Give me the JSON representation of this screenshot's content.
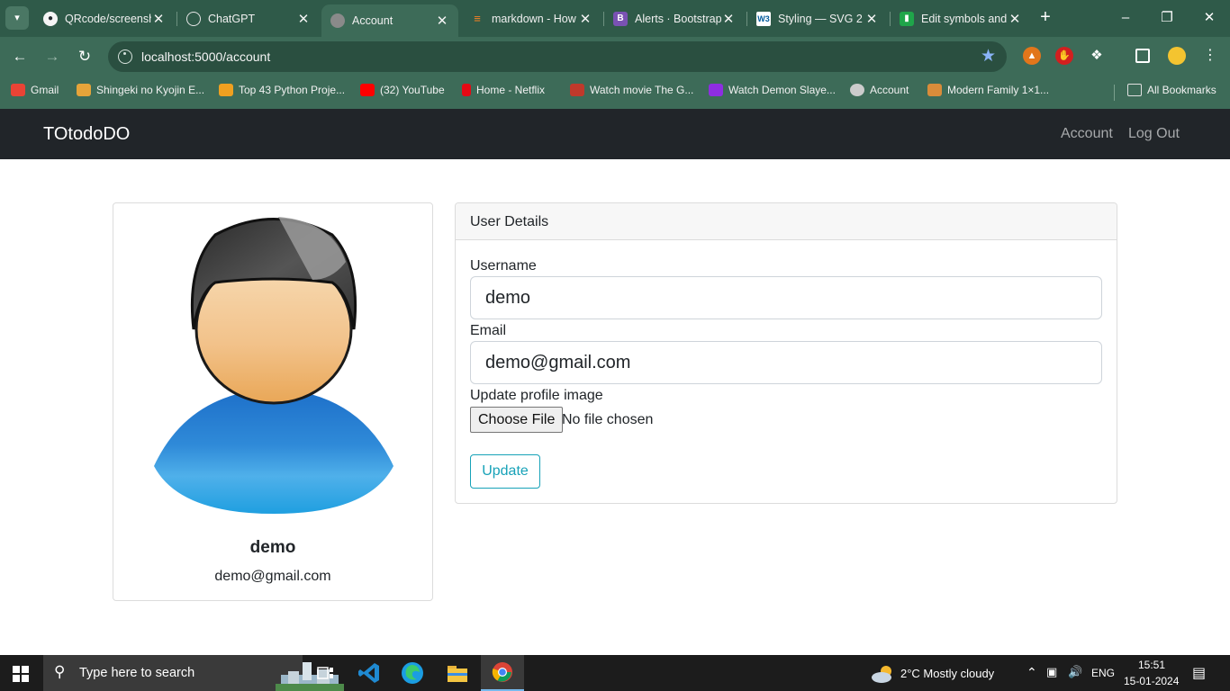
{
  "browser": {
    "tabs": [
      {
        "title": "QRcode/screensh",
        "favicon": "github-icon",
        "color": "#24292e"
      },
      {
        "title": "ChatGPT",
        "favicon": "openai-icon",
        "color": "#6b8f7e"
      },
      {
        "title": "Account",
        "favicon": "globe-icon",
        "color": "#888888",
        "active": true
      },
      {
        "title": "markdown - How",
        "favicon": "stackoverflow-icon",
        "color": "#f48024"
      },
      {
        "title": "Alerts · Bootstrap",
        "favicon": "bootstrap-icon",
        "color": "#7952b3"
      },
      {
        "title": "Styling — SVG 2",
        "favicon": "w3c-icon",
        "color": "#005a9c"
      },
      {
        "title": "Edit symbols and",
        "favicon": "editor-icon",
        "color": "#1fa54a"
      }
    ],
    "address": "localhost:5000/account",
    "bookmarks": [
      {
        "label": "Gmail",
        "color": "#ea4335"
      },
      {
        "label": "Shingeki no Kyojin E...",
        "color": "#e6a43a"
      },
      {
        "label": "Top 43 Python Proje...",
        "color": "#f0a020"
      },
      {
        "label": "(32) YouTube",
        "color": "#ff0000"
      },
      {
        "label": "Home - Netflix",
        "color": "#e50914"
      },
      {
        "label": "Watch movie The G...",
        "color": "#c0392b"
      },
      {
        "label": "Watch Demon Slaye...",
        "color": "#8e2de2"
      },
      {
        "label": "Account",
        "color": "#cccccc"
      },
      {
        "label": "Modern Family 1×1...",
        "color": "#d98c3a"
      }
    ],
    "all_bookmarks": "All Bookmarks"
  },
  "app": {
    "brand": "TOtodoDO",
    "nav": {
      "account": "Account",
      "logout": "Log Out"
    }
  },
  "profile": {
    "name": "demo",
    "email": "demo@gmail.com"
  },
  "details": {
    "header": "User Details",
    "username_label": "Username",
    "username_value": "demo",
    "email_label": "Email",
    "email_value": "demo@gmail.com",
    "image_label": "Update profile image",
    "choose_file": "Choose File",
    "file_status": "No file chosen",
    "update_button": "Update"
  },
  "taskbar": {
    "search_placeholder": "Type here to search",
    "weather": "2°C  Mostly cloudy",
    "language": "ENG",
    "time": "15:51",
    "date": "15-01-2024"
  }
}
